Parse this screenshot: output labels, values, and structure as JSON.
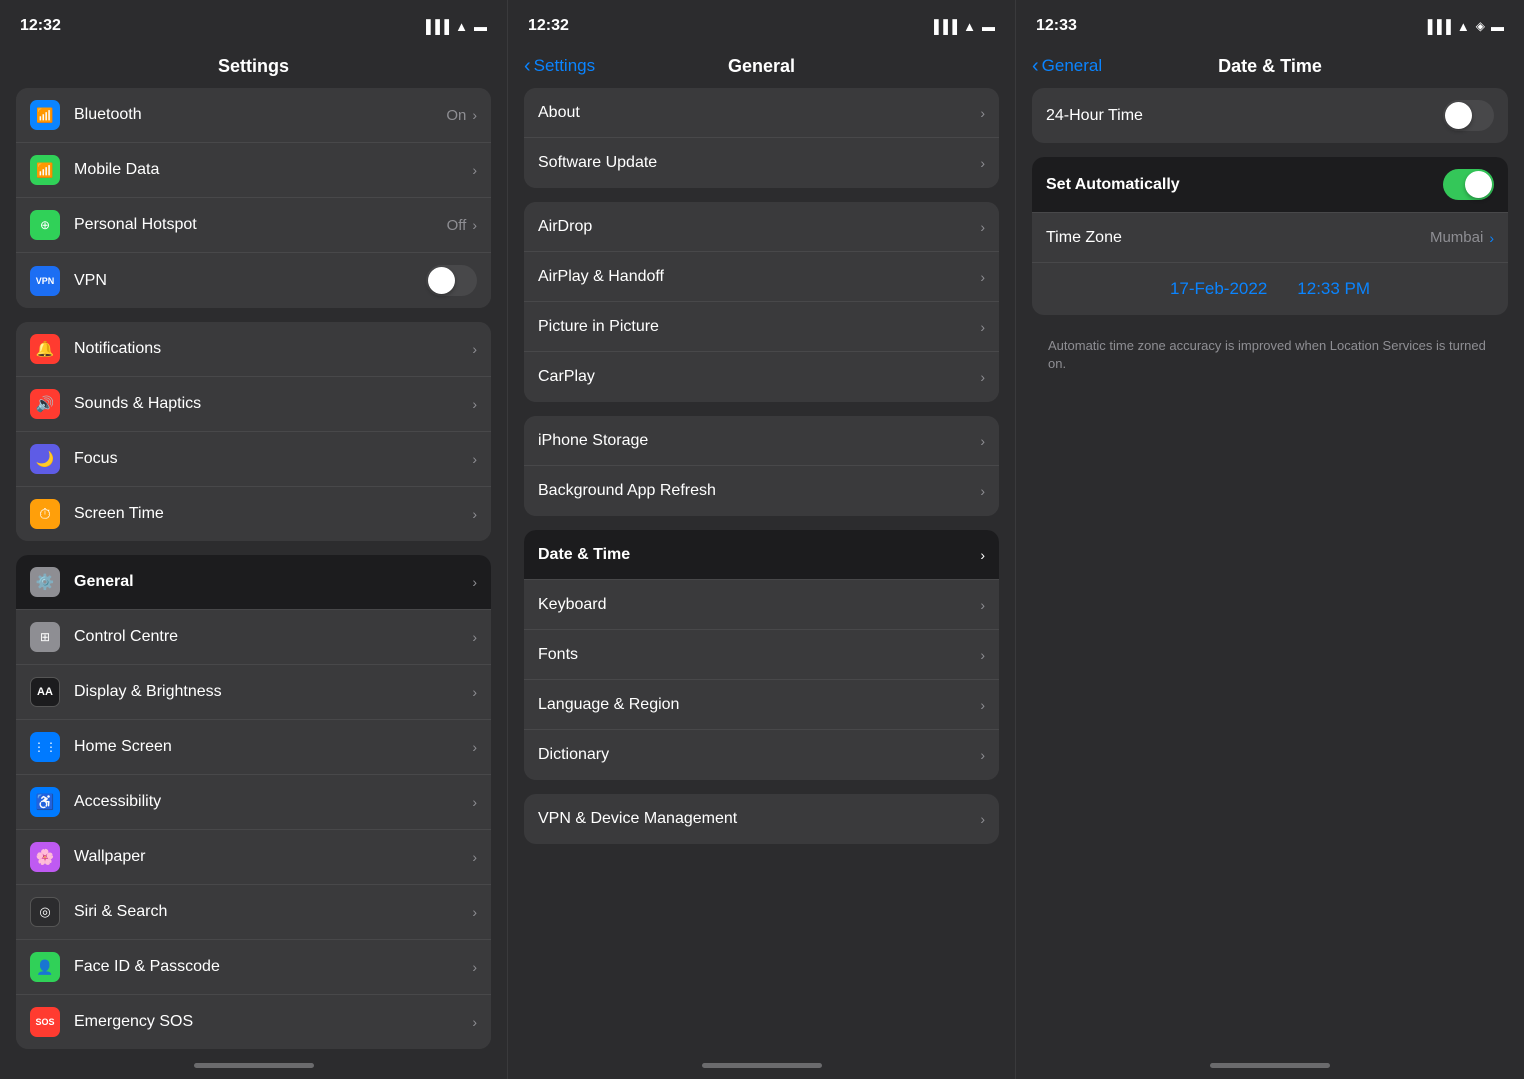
{
  "panel1": {
    "statusTime": "12:32",
    "navTitle": "Settings",
    "sections": [
      {
        "items": [
          {
            "icon": "bluetooth",
            "iconBg": "#0a84ff",
            "iconChar": "🔵",
            "label": "Bluetooth",
            "value": "On",
            "hasChevron": true
          },
          {
            "icon": "mobile",
            "iconBg": "#30d158",
            "iconChar": "📶",
            "label": "Mobile Data",
            "value": "",
            "hasChevron": true
          },
          {
            "icon": "hotspot",
            "iconBg": "#30d158",
            "iconChar": "📡",
            "label": "Personal Hotspot",
            "value": "Off",
            "hasChevron": true
          },
          {
            "icon": "vpn",
            "iconBg": "#1c6ef3",
            "iconChar": "VPN",
            "label": "VPN",
            "value": "",
            "hasToggle": true,
            "toggleOn": false,
            "hasChevron": false
          }
        ]
      },
      {
        "items": [
          {
            "icon": "notifications",
            "iconBg": "#ff3b30",
            "iconChar": "🔔",
            "label": "Notifications",
            "value": "",
            "hasChevron": true
          },
          {
            "icon": "sounds",
            "iconBg": "#ff3b30",
            "iconChar": "🔊",
            "label": "Sounds & Haptics",
            "value": "",
            "hasChevron": true
          },
          {
            "icon": "focus",
            "iconBg": "#5e5ce6",
            "iconChar": "🌙",
            "label": "Focus",
            "value": "",
            "hasChevron": true
          },
          {
            "icon": "screentime",
            "iconBg": "#ff9f0a",
            "iconChar": "⏱",
            "label": "Screen Time",
            "value": "",
            "hasChevron": true
          }
        ]
      },
      {
        "items": [
          {
            "icon": "general",
            "iconBg": "#8e8e93",
            "iconChar": "⚙️",
            "label": "General",
            "value": "",
            "hasChevron": true,
            "active": true
          },
          {
            "icon": "control",
            "iconBg": "#8e8e93",
            "iconChar": "⊞",
            "label": "Control Centre",
            "value": "",
            "hasChevron": true
          },
          {
            "icon": "display",
            "iconBg": "#1c1c1e",
            "iconChar": "AA",
            "label": "Display & Brightness",
            "value": "",
            "hasChevron": true
          },
          {
            "icon": "homescreen",
            "iconBg": "#007aff",
            "iconChar": "⋮⋮⋮",
            "label": "Home Screen",
            "value": "",
            "hasChevron": true
          },
          {
            "icon": "accessibility",
            "iconBg": "#007aff",
            "iconChar": "♿",
            "label": "Accessibility",
            "value": "",
            "hasChevron": true
          },
          {
            "icon": "wallpaper",
            "iconBg": "#bf5af2",
            "iconChar": "🌸",
            "label": "Wallpaper",
            "value": "",
            "hasChevron": true
          },
          {
            "icon": "siri",
            "iconBg": "#2c2c2e",
            "iconChar": "◎",
            "label": "Siri & Search",
            "value": "",
            "hasChevron": true
          },
          {
            "icon": "faceid",
            "iconBg": "#30d158",
            "iconChar": "👤",
            "label": "Face ID & Passcode",
            "value": "",
            "hasChevron": true
          },
          {
            "icon": "emergency",
            "iconBg": "#ff3b30",
            "iconChar": "SOS",
            "label": "Emergency SOS",
            "value": "",
            "hasChevron": true
          }
        ]
      }
    ]
  },
  "panel2": {
    "statusTime": "12:32",
    "navTitle": "General",
    "navBack": "Settings",
    "sections": [
      {
        "items": [
          {
            "label": "About",
            "hasChevron": true
          },
          {
            "label": "Software Update",
            "hasChevron": true
          }
        ]
      },
      {
        "items": [
          {
            "label": "AirDrop",
            "hasChevron": true
          },
          {
            "label": "AirPlay & Handoff",
            "hasChevron": true
          },
          {
            "label": "Picture in Picture",
            "hasChevron": true
          },
          {
            "label": "CarPlay",
            "hasChevron": true
          }
        ]
      },
      {
        "items": [
          {
            "label": "iPhone Storage",
            "hasChevron": true
          },
          {
            "label": "Background App Refresh",
            "hasChevron": true
          }
        ]
      },
      {
        "items": [
          {
            "label": "Date & Time",
            "hasChevron": true,
            "active": true
          },
          {
            "label": "Keyboard",
            "hasChevron": true
          },
          {
            "label": "Fonts",
            "hasChevron": true
          },
          {
            "label": "Language & Region",
            "hasChevron": true
          },
          {
            "label": "Dictionary",
            "hasChevron": true
          }
        ]
      },
      {
        "items": [
          {
            "label": "VPN & Device Management",
            "hasChevron": true
          }
        ]
      }
    ]
  },
  "panel3": {
    "statusTime": "12:33",
    "navTitle": "Date & Time",
    "navBack": "General",
    "sections": [
      {
        "items": [
          {
            "label": "24-Hour Time",
            "hasToggle": true,
            "toggleOn": false
          }
        ]
      },
      {
        "items": [
          {
            "label": "Set Automatically",
            "hasToggle": true,
            "toggleOn": true,
            "active": true
          },
          {
            "label": "Time Zone",
            "value": "Mumbai",
            "hasChevron": true
          }
        ]
      }
    ],
    "dateValue": "17-Feb-2022",
    "timeValue": "12:33 PM",
    "hint": "Automatic time zone accuracy is improved when Location Services is turned on."
  },
  "icons": {
    "bluetooth": "⬤",
    "wifi": "WiFi",
    "battery": "🔋"
  }
}
